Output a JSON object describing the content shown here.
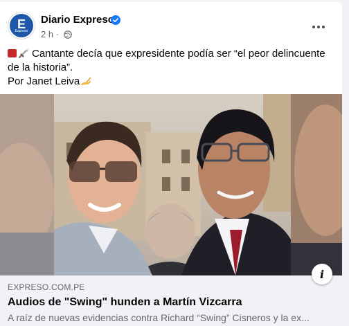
{
  "post": {
    "page_name": "Diario Expreso",
    "verified_icon": "verified-badge-icon",
    "time": "2 h",
    "privacy_icon": "globe-icon",
    "avatar_letter": "E",
    "avatar_brand": "Expreso",
    "text_line1": "Cantante decía que expresidente podía ser “el peor delincuente",
    "text_line2": "de la historia”.",
    "text_line3": "Por Janet Leiva",
    "colors": {
      "accent": "#1877f2",
      "brand": "#1f58a8",
      "muted": "#65676b"
    }
  },
  "link_preview": {
    "domain": "EXPRESO.COM.PE",
    "title": "Audios de \"Swing\" hunden a Martín Vizcarra",
    "description": "A raíz de nuevas evidencias contra Richard “Swing” Cisneros y la ex..."
  },
  "icons": {
    "more": "more-options-icon",
    "info": "info-icon",
    "emoji1": "red-box-emoji",
    "emoji2": "sword-emoji",
    "emoji3": "writing-hand-emoji"
  }
}
